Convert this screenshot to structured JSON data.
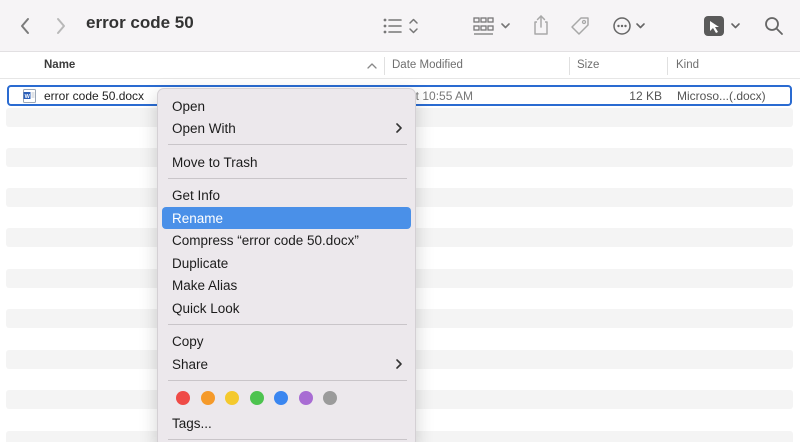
{
  "toolbar": {
    "title": "error code 50",
    "icons": [
      "chevron-left-icon",
      "chevron-right-icon",
      "list-view-icon",
      "grid-view-icon",
      "share-icon",
      "tag-icon",
      "ellipsis-icon",
      "app-icon",
      "search-icon"
    ]
  },
  "columns": {
    "name": "Name",
    "date_modified": "Date Modified",
    "size": "Size",
    "kind": "Kind"
  },
  "file": {
    "name": "error code 50.docx",
    "date_modified": "ay at 10:55 AM",
    "size": "12 KB",
    "kind": "Microso...(.docx)"
  },
  "context_menu": {
    "items": [
      {
        "label": "Open"
      },
      {
        "label": "Open With"
      },
      {
        "label": "Move to Trash"
      },
      {
        "label": "Get Info"
      },
      {
        "label": "Rename",
        "highlighted": true
      },
      {
        "label": "Compress “error code 50.docx”"
      },
      {
        "label": "Duplicate"
      },
      {
        "label": "Make Alias"
      },
      {
        "label": "Quick Look"
      },
      {
        "label": "Copy"
      },
      {
        "label": "Share"
      },
      {
        "label": "Tags..."
      }
    ],
    "tag_colors": [
      {
        "name": "red",
        "hex": "#ef4b47"
      },
      {
        "name": "orange",
        "hex": "#f59a2a"
      },
      {
        "name": "yellow",
        "hex": "#f4c92d"
      },
      {
        "name": "green",
        "hex": "#4dc34f"
      },
      {
        "name": "blue",
        "hex": "#3a86f0"
      },
      {
        "name": "purple",
        "hex": "#a86cd3"
      },
      {
        "name": "gray",
        "hex": "#9b9b9b"
      }
    ]
  },
  "colors": {
    "selection_border": "#2a6bd1",
    "menu_highlight": "#4a90e8"
  }
}
